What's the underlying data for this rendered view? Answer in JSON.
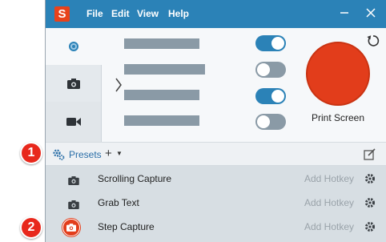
{
  "app": {
    "logo_letter": "S",
    "menu": [
      "File",
      "Edit",
      "View",
      "Help"
    ],
    "accent": "#2b82b7",
    "capture_color": "#e23d1b"
  },
  "capture_tabs": [
    {
      "icon": "target-icon",
      "active": true
    },
    {
      "icon": "camera-icon",
      "active": false
    },
    {
      "icon": "video-camera-icon",
      "active": false
    }
  ],
  "settings_toggles": [
    {
      "on": true
    },
    {
      "on": false
    },
    {
      "on": true
    },
    {
      "on": false
    }
  ],
  "capture_button": {
    "label": "Print Screen"
  },
  "presets_bar": {
    "label": "Presets",
    "add_label": "+"
  },
  "presets": [
    {
      "name": "Scrolling Capture",
      "hotkey": "Add Hotkey",
      "icon": "camera-icon"
    },
    {
      "name": "Grab Text",
      "hotkey": "Add Hotkey",
      "icon": "camera-icon"
    },
    {
      "name": "Step Capture",
      "hotkey": "Add Hotkey",
      "icon": "camera-icon"
    }
  ],
  "callouts": [
    "1",
    "2"
  ]
}
